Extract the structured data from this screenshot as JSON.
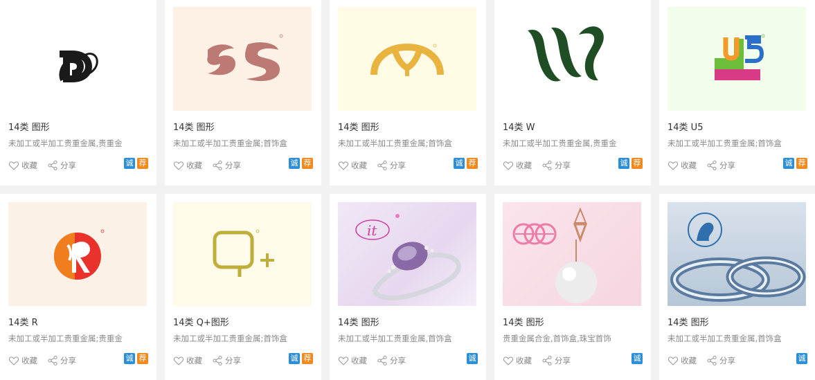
{
  "action_labels": {
    "favorite": "收藏",
    "share": "分享"
  },
  "badge_labels": {
    "cheng": "诚",
    "jian": "荐"
  },
  "colors": {
    "cheng_badge": "#2d8ed8",
    "jian_badge": "#f08a1e"
  },
  "cards": [
    {
      "title": "14类 图形",
      "desc": "未加工或半加工贵重金属,贵重金",
      "badges": [
        "诚",
        "荐"
      ],
      "image": "black-d-logo"
    },
    {
      "title": "14类 图形",
      "desc": "未加工或半加工贵重金属;首饰盒",
      "badges": [
        "诚",
        "荐"
      ],
      "image": "bs-logo"
    },
    {
      "title": "14类 图形",
      "desc": "未加工或半加工贵重金属;首饰盒",
      "badges": [
        "诚",
        "荐"
      ],
      "image": "gold-arch-logo"
    },
    {
      "title": "14类 W",
      "desc": "未加工或半加工贵重金属,贵重金",
      "badges": [
        "诚",
        "荐"
      ],
      "image": "w-logo"
    },
    {
      "title": "14类 U5",
      "desc": "未加工或半加工贵重金属;首饰盒",
      "badges": [
        "诚",
        "荐"
      ],
      "image": "u5-logo"
    },
    {
      "title": "14类 R",
      "desc": "未加工或半加工贵重金属;贵重金",
      "badges": [
        "诚",
        "荐"
      ],
      "image": "r-logo"
    },
    {
      "title": "14类 Q+图形",
      "desc": "未加工或半加工贵重金属;首饰盒",
      "badges": [
        "诚",
        "荐"
      ],
      "image": "q-plus-logo"
    },
    {
      "title": "14类 图形",
      "desc": "未加工或半加工贵重金属,首饰盒",
      "badges": [
        "诚"
      ],
      "image": "it-ring-photo"
    },
    {
      "title": "14类 图形",
      "desc": "贵重金属合金,首饰盒,珠宝首饰",
      "badges": [
        "诚"
      ],
      "image": "pearl-pendant-photo"
    },
    {
      "title": "14类 图形",
      "desc": "未加工或半加工贵重金属,首饰盒",
      "badges": [
        "诚"
      ],
      "image": "rings-photo"
    }
  ]
}
